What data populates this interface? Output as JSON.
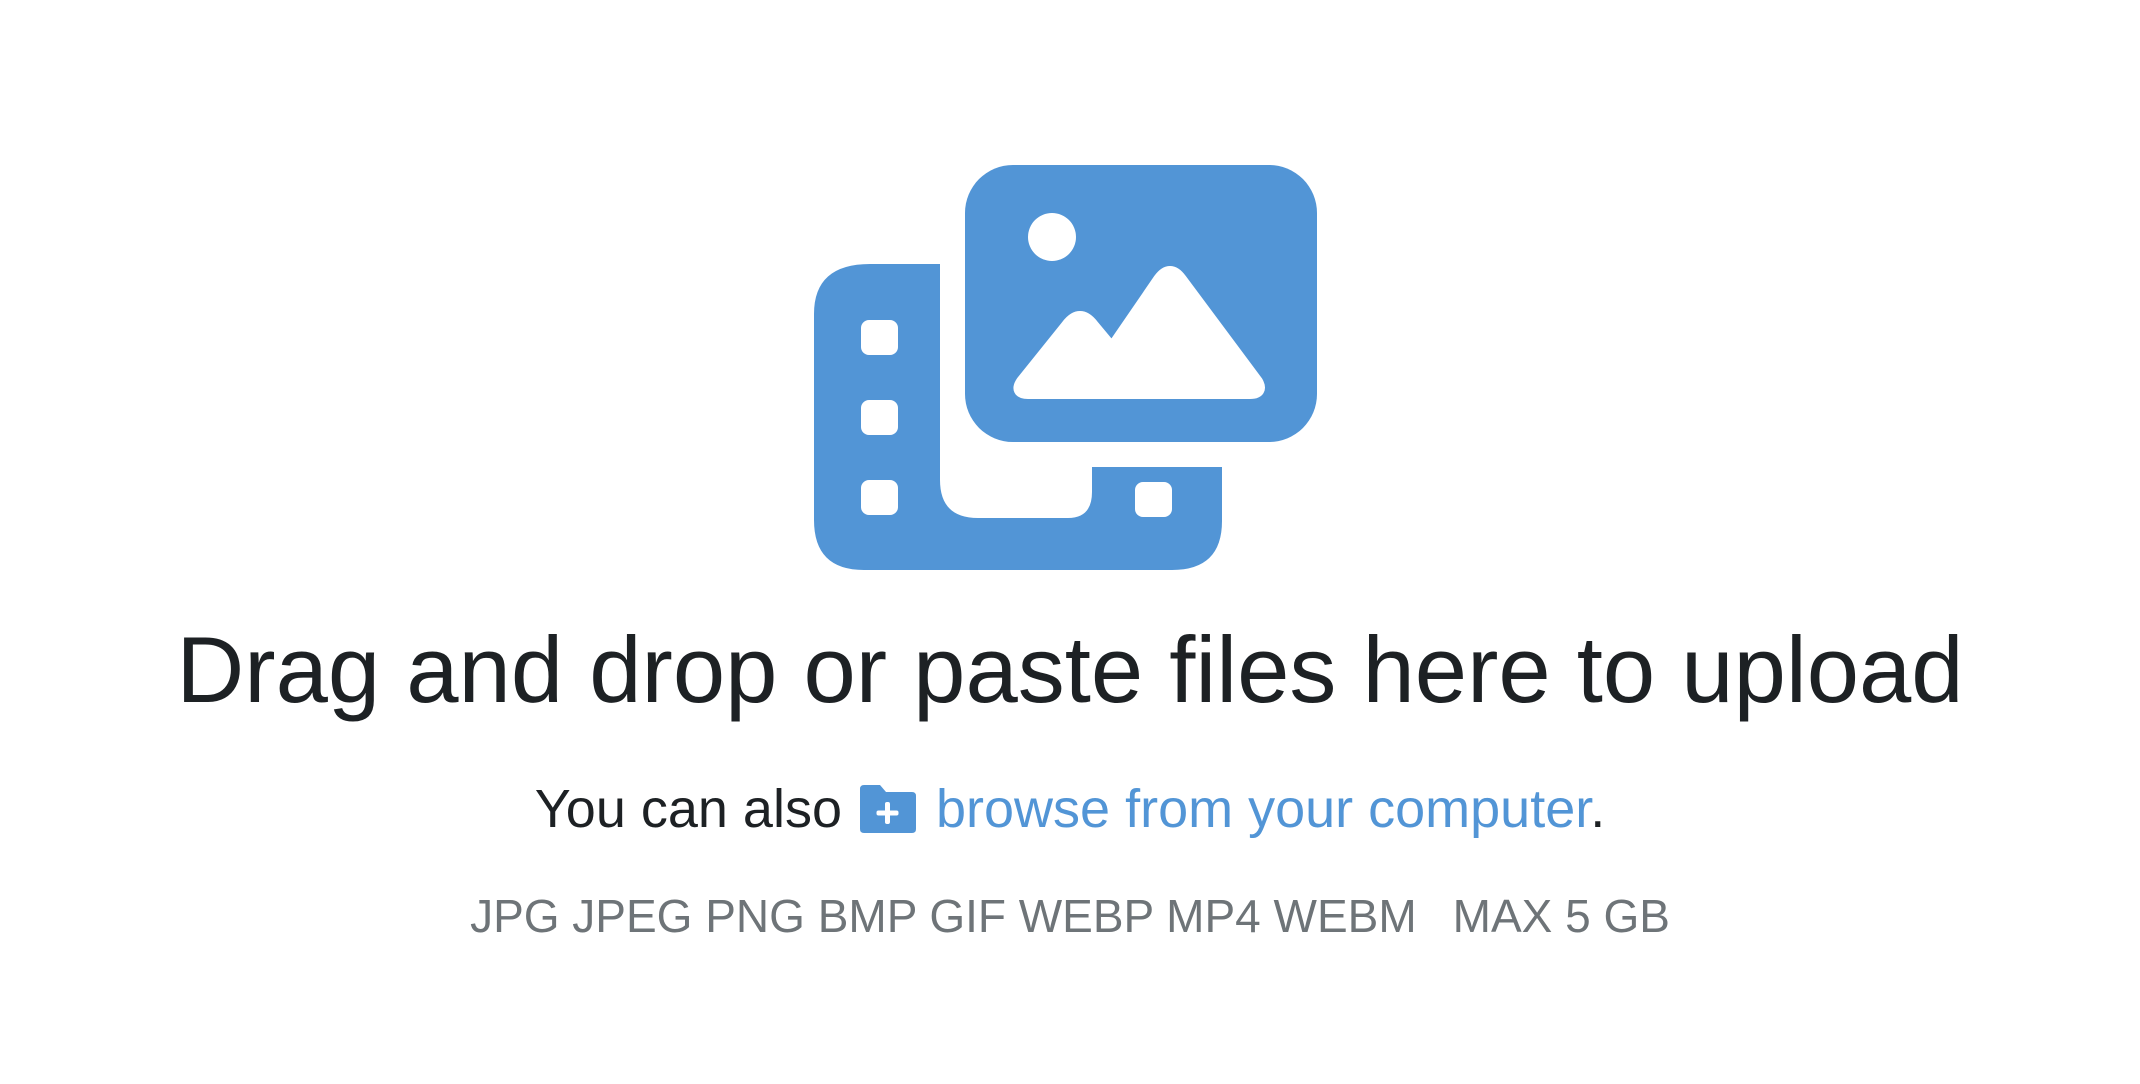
{
  "headline": "Drag and drop or paste files here to upload",
  "subline": {
    "prefix": "You can also",
    "browse_label": "browse from your computer",
    "suffix": "."
  },
  "formats": {
    "list": "JPG JPEG PNG BMP GIF WEBP MP4 WEBM",
    "max_size": "MAX 5 GB"
  },
  "icons": {
    "hero": "image-and-video-icon",
    "browse": "folder-plus-icon"
  },
  "colors": {
    "accent": "#5295d6",
    "text": "#1d2124",
    "muted": "#6e7478",
    "background": "#ffffff"
  }
}
